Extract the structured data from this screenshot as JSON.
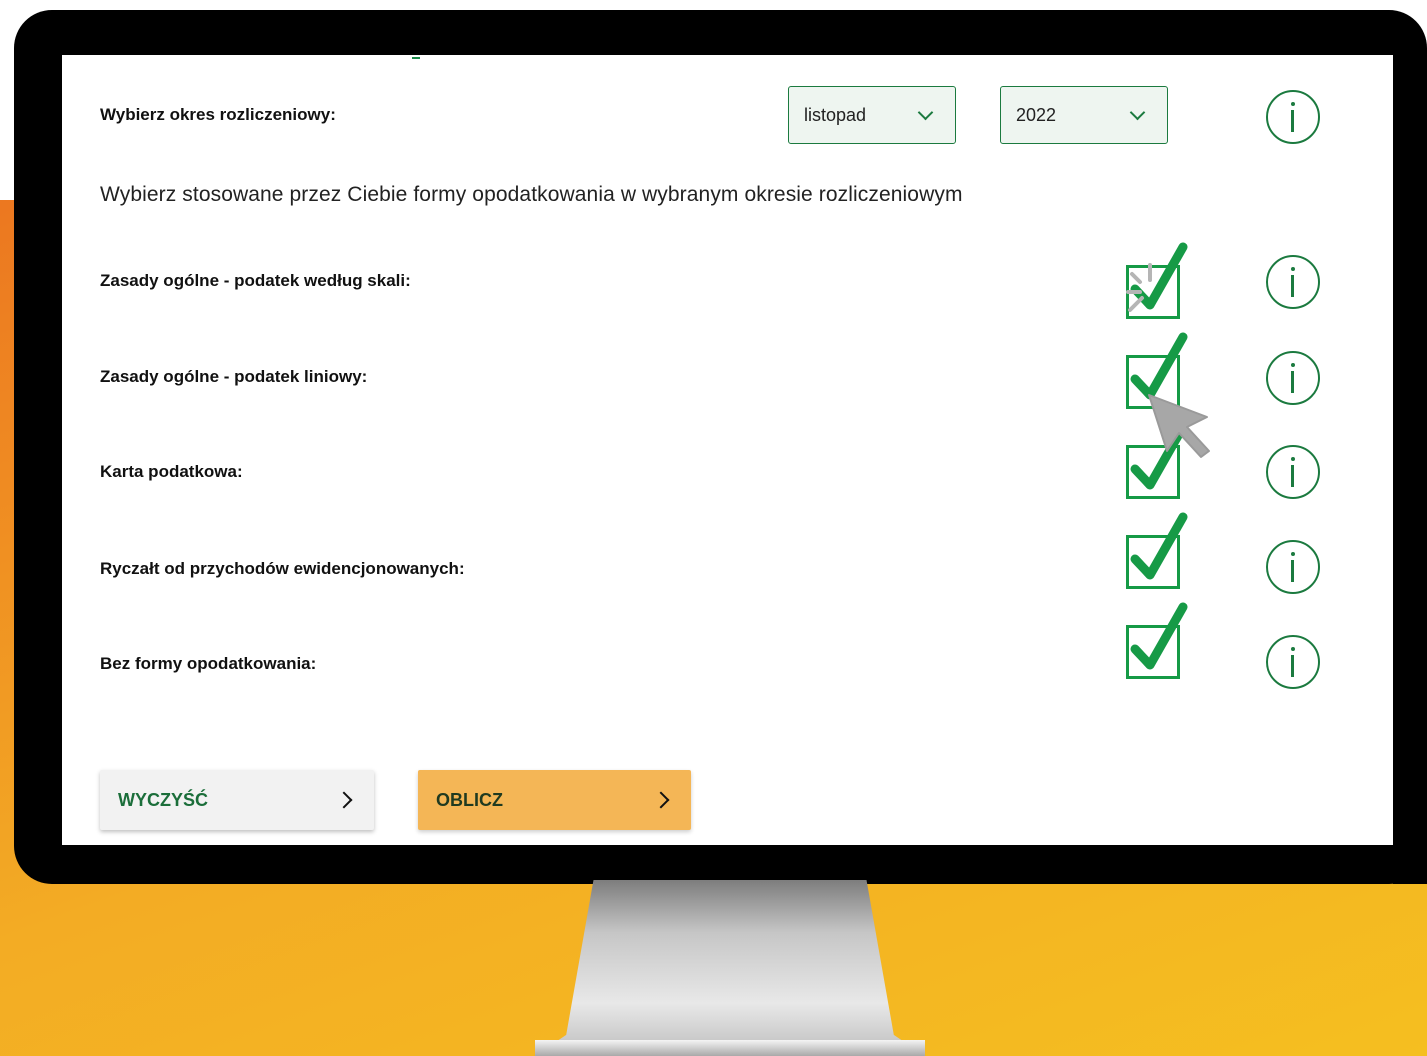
{
  "form": {
    "period_label": "Wybierz okres rozliczeniowy:",
    "month_select": {
      "value": "listopad"
    },
    "year_select": {
      "value": "2022"
    },
    "subtitle": "Wybierz stosowane przez Ciebie formy opodatkowania w wybranym okresie rozliczeniowym",
    "options": [
      {
        "label": "Zasady ogólne - podatek według skali:",
        "checked": true
      },
      {
        "label": "Zasady ogólne - podatek liniowy:",
        "checked": true
      },
      {
        "label": "Karta podatkowa:",
        "checked": true
      },
      {
        "label": "Ryczałt od przychodów ewidencjonowanych:",
        "checked": true
      },
      {
        "label": "Bez formy opodatkowania:",
        "checked": true
      }
    ]
  },
  "buttons": {
    "clear_label": "WYCZYŚĆ",
    "calculate_label": "OBLICZ"
  },
  "colors": {
    "accent_green": "#1b7a3f",
    "check_green": "#169a46",
    "button_orange": "#f4b656",
    "background_orange": "#f0a024"
  },
  "icons": {
    "info": "info-icon",
    "chevron": "chevron-down-icon",
    "arrow": "chevron-right-icon",
    "cursor": "mouse-pointer-icon"
  }
}
